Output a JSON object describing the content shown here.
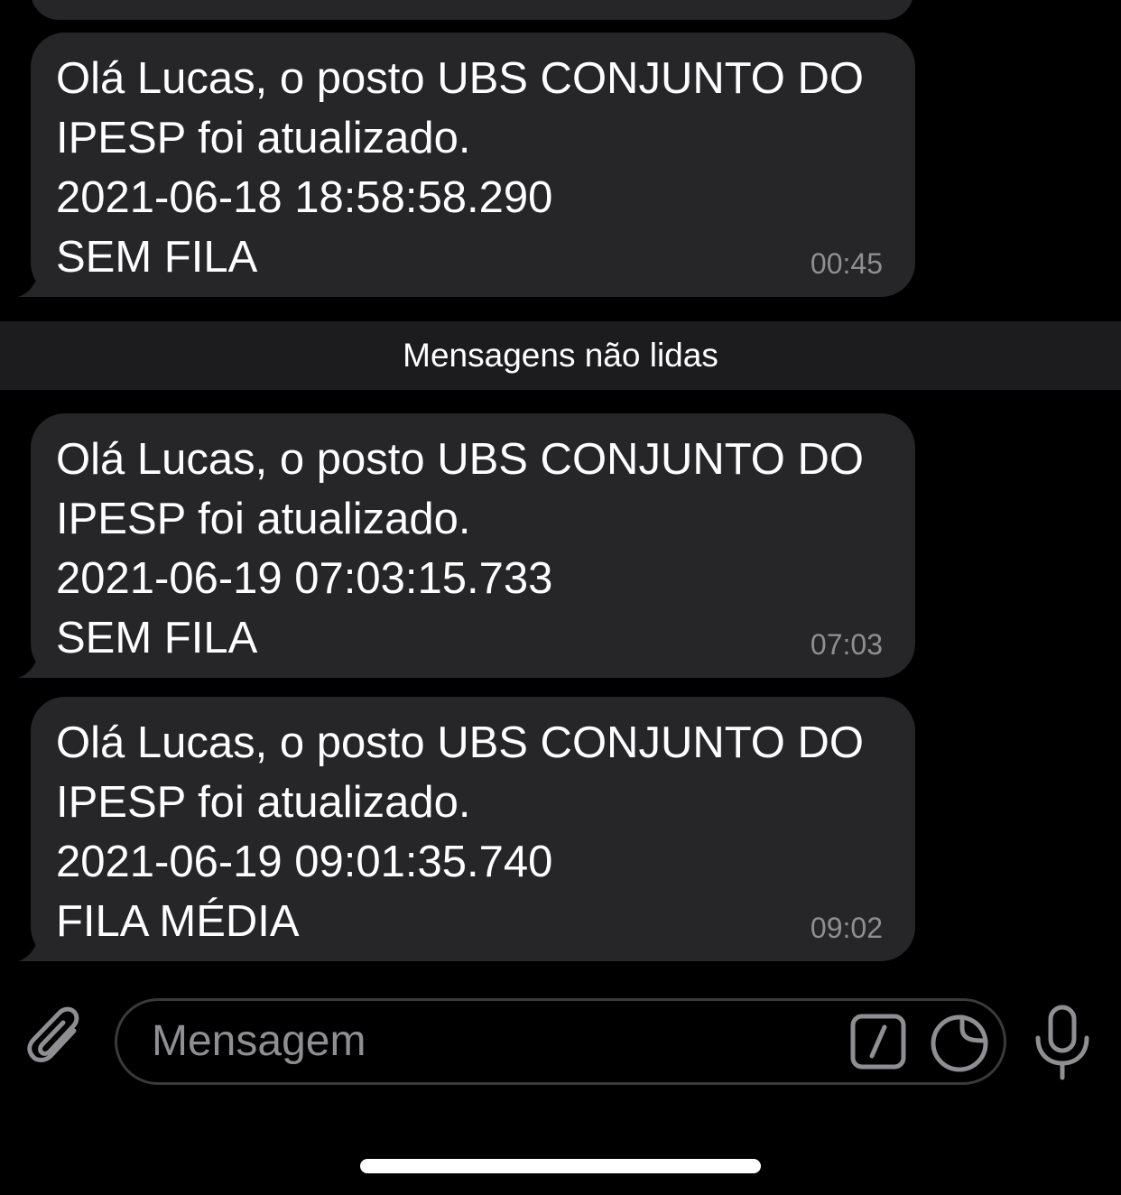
{
  "divider": {
    "label": "Mensagens não lidas"
  },
  "messages": [
    {
      "lines": [
        "Olá Lucas, o posto UBS CONJUNTO DO",
        "IPESP foi atualizado.",
        "2021-06-18 18:58:58.290",
        "SEM FILA"
      ],
      "time": "00:45"
    },
    {
      "lines": [
        "Olá Lucas, o posto UBS CONJUNTO DO",
        "IPESP foi atualizado.",
        "2021-06-19 07:03:15.733",
        "SEM FILA"
      ],
      "time": "07:03"
    },
    {
      "lines": [
        "Olá Lucas, o posto UBS CONJUNTO DO",
        "IPESP foi atualizado.",
        "2021-06-19 09:01:35.740",
        "FILA MÉDIA"
      ],
      "time": "09:02"
    }
  ],
  "composer": {
    "placeholder": "Mensagem",
    "icons": {
      "attach": "paperclip-icon",
      "commands": "slash-command-icon",
      "sticker": "sticker-icon",
      "voice": "microphone-icon"
    }
  },
  "colors": {
    "background": "#000000",
    "bubble": "#262628",
    "divider_bg": "#1c1c1e",
    "timestamp": "#8e8e93",
    "icon": "#8e8e93"
  }
}
